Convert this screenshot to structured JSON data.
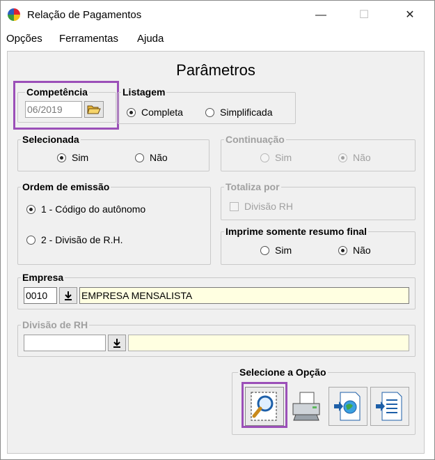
{
  "window": {
    "title": "Relação de Pagamentos",
    "minimize": "—",
    "maximize": "☐",
    "close": "✕"
  },
  "menu": [
    "Opções",
    "Ferramentas",
    "Ajuda"
  ],
  "heading": "Parâmetros",
  "competencia": {
    "legend": "Competência",
    "value": "06/2019",
    "browse_icon": "folder-open-icon"
  },
  "listagem": {
    "legend": "Listagem",
    "options": [
      "Completa",
      "Simplificada"
    ],
    "selected": "Completa"
  },
  "selecionada": {
    "legend": "Selecionada",
    "options": [
      "Sim",
      "Não"
    ],
    "selected": "Sim"
  },
  "continuacao": {
    "legend": "Continuação",
    "options": [
      "Sim",
      "Não"
    ],
    "selected": "Não",
    "disabled": true
  },
  "ordem": {
    "legend": "Ordem de emissão",
    "options": [
      "1 - Código do autônomo",
      "2 - Divisão de R.H."
    ],
    "selected": "1 - Código do autônomo"
  },
  "totaliza": {
    "legend": "Totaliza por",
    "option": "Divisão RH",
    "checked": false,
    "disabled": true
  },
  "imprime": {
    "legend": "Imprime somente resumo final",
    "options": [
      "Sim",
      "Não"
    ],
    "selected": "Não"
  },
  "empresa": {
    "legend": "Empresa",
    "code": "0010",
    "name": "EMPRESA MENSALISTA"
  },
  "divisao": {
    "legend": "Divisão de RH",
    "code": "",
    "name": "",
    "disabled": true
  },
  "selecione": {
    "legend": "Selecione a Opção",
    "buttons": [
      "preview-icon",
      "printer-icon",
      "export-web-icon",
      "export-document-icon"
    ]
  },
  "colors": {
    "highlight": "#9b4fb8",
    "field_yellow": "#ffffe1",
    "disabled_text": "#a0a0a0"
  }
}
